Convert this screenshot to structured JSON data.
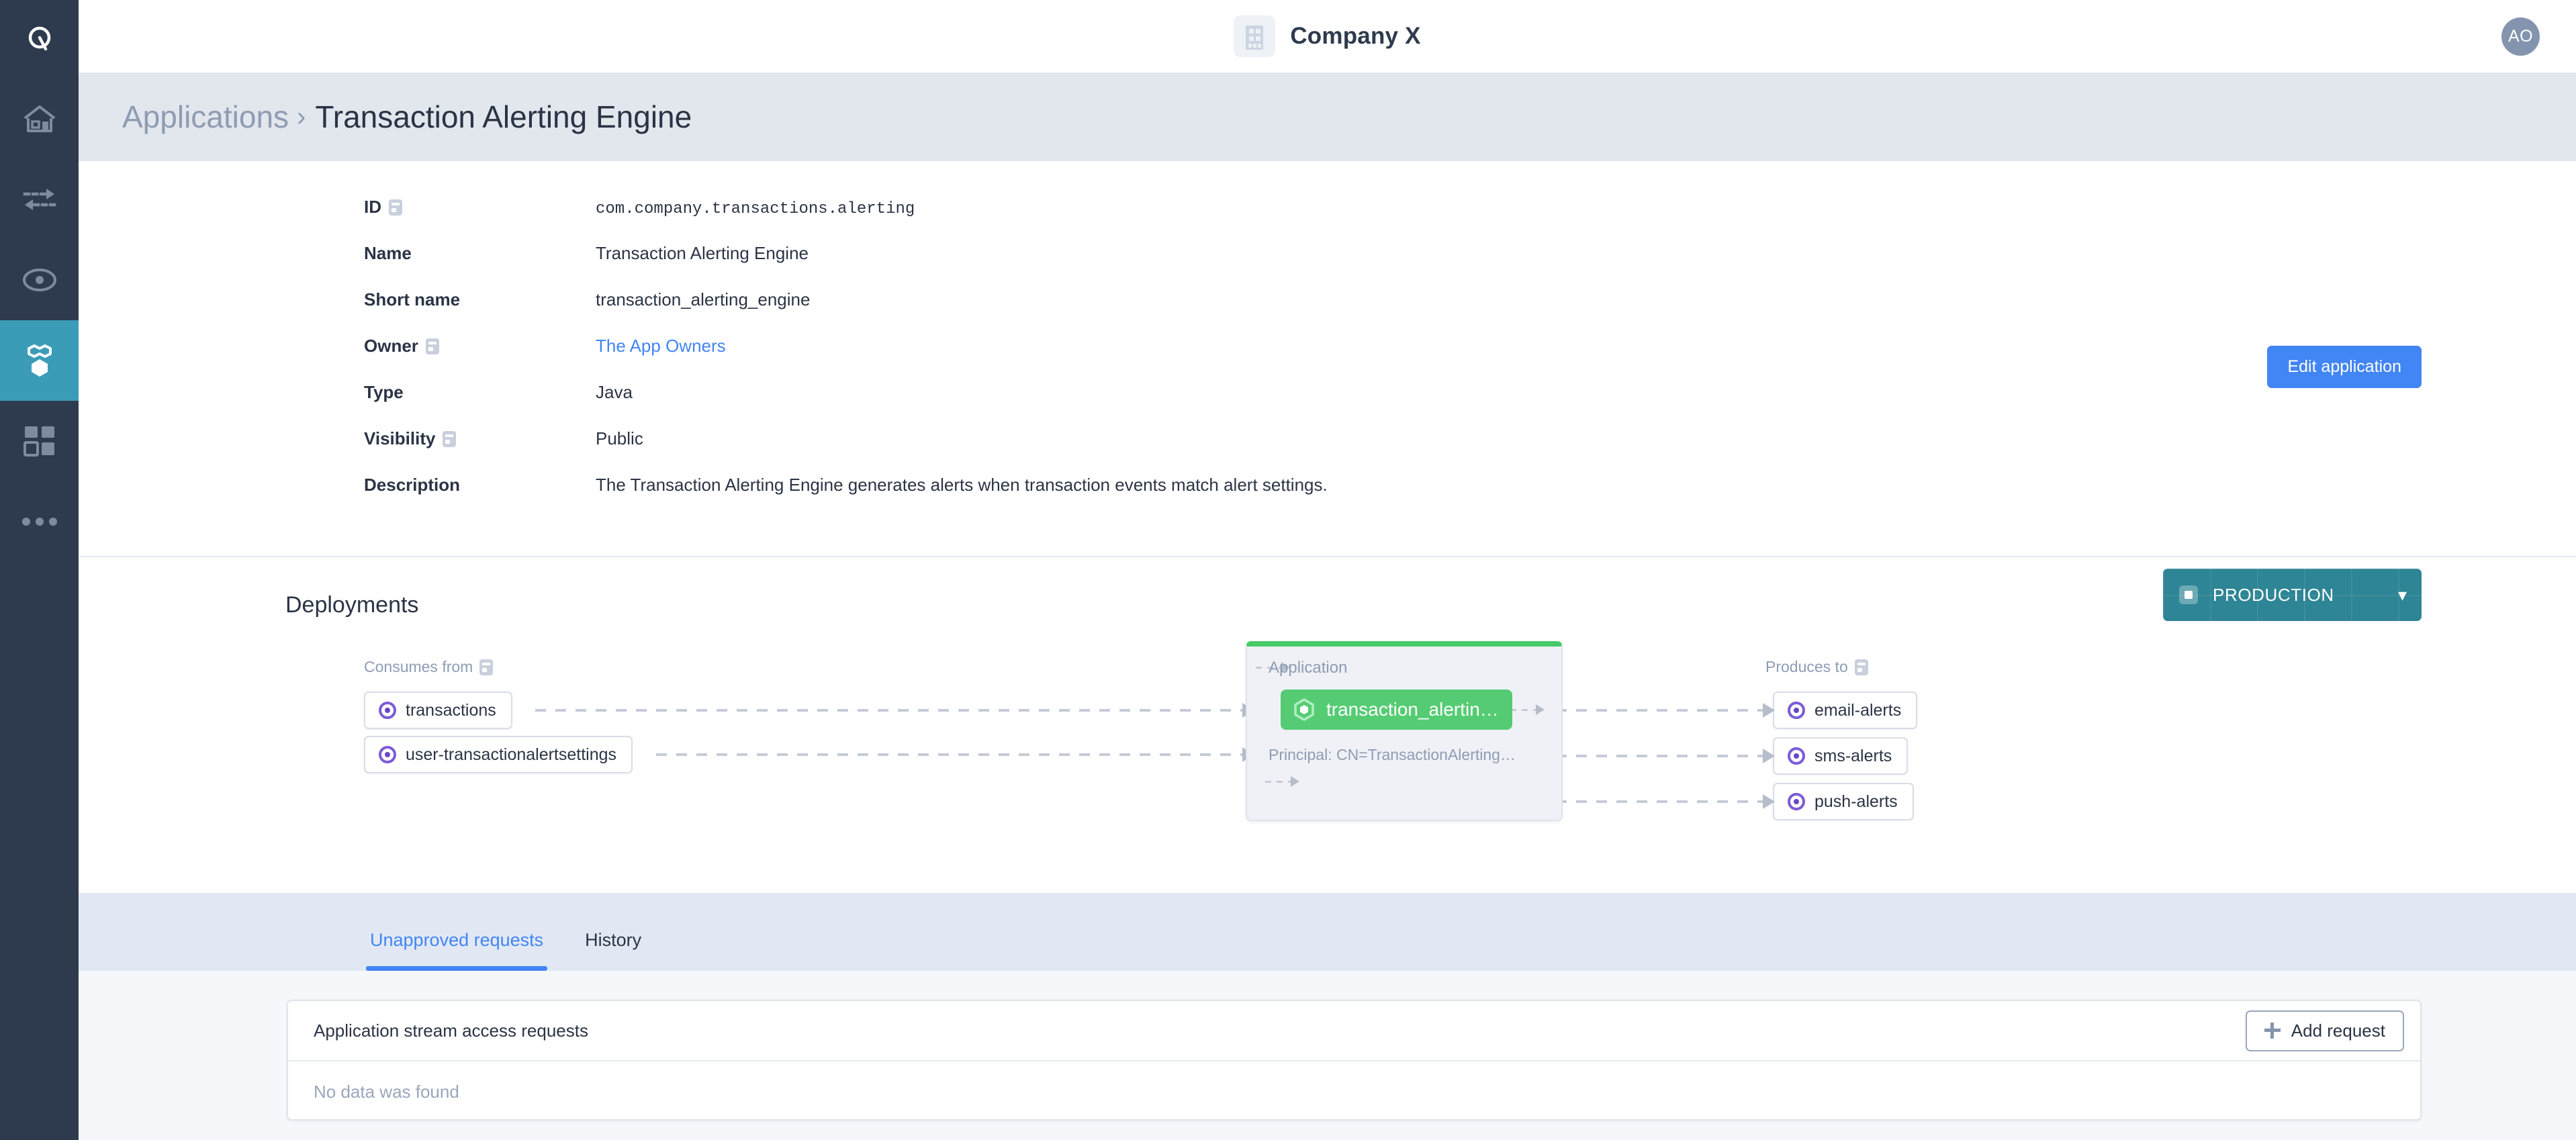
{
  "rail": {
    "logo_icon": "quantexa-q-logo-icon",
    "items": [
      {
        "name": "home",
        "icon": "home-icon",
        "active": false
      },
      {
        "name": "flows",
        "icon": "exchange-arrows-icon",
        "active": false
      },
      {
        "name": "topics",
        "icon": "record-eye-icon",
        "active": false
      },
      {
        "name": "applications",
        "icon": "hexagon-nodes-icon",
        "active": true
      },
      {
        "name": "dashboard",
        "icon": "grid-squares-icon",
        "active": false
      },
      {
        "name": "more",
        "icon": "ellipsis-icon",
        "active": false
      }
    ]
  },
  "topbar": {
    "company_icon": "building-icon",
    "company_name": "Company X",
    "avatar_initials": "AO"
  },
  "breadcrumb": {
    "parent": "Applications",
    "separator": "›",
    "current": "Transaction Alerting Engine"
  },
  "details": {
    "edit_button": "Edit application",
    "fields": [
      {
        "label": "ID",
        "value": "com.company.transactions.alerting",
        "mono": true,
        "info": true,
        "link": false
      },
      {
        "label": "Name",
        "value": "Transaction Alerting Engine",
        "mono": false,
        "info": false,
        "link": false
      },
      {
        "label": "Short name",
        "value": "transaction_alerting_engine",
        "mono": false,
        "info": false,
        "link": false
      },
      {
        "label": "Owner",
        "value": "The App Owners",
        "mono": false,
        "info": true,
        "link": true
      },
      {
        "label": "Type",
        "value": "Java",
        "mono": false,
        "info": false,
        "link": false
      },
      {
        "label": "Visibility",
        "value": "Public",
        "mono": false,
        "info": true,
        "link": false
      },
      {
        "label": "Description",
        "value": "The Transaction Alerting Engine generates alerts when transaction events match alert settings.",
        "mono": false,
        "info": false,
        "link": false
      }
    ]
  },
  "deployments": {
    "title": "Deployments",
    "environment": {
      "label": "PRODUCTION",
      "icon": "environment-square-icon",
      "caret": "⌄",
      "color": "#2d8595"
    },
    "consumes_heading": "Consumes from",
    "produces_heading": "Produces to",
    "consumes": [
      {
        "name": "transactions"
      },
      {
        "name": "user-transactionalertsettings"
      }
    ],
    "produces": [
      {
        "name": "email-alerts"
      },
      {
        "name": "sms-alerts"
      },
      {
        "name": "push-alerts"
      }
    ],
    "node": {
      "kind": "Application",
      "name": "transaction_alertin…",
      "principal": "Principal: CN=TransactionAlerting…",
      "accent_color": "#47ca68",
      "pill_color": "#55cc73"
    }
  },
  "tabs": [
    {
      "label": "Unapproved requests",
      "active": true
    },
    {
      "label": "History",
      "active": false
    }
  ],
  "requests_panel": {
    "title": "Application stream access requests",
    "add_button": "Add request",
    "empty_text": "No data was found"
  }
}
